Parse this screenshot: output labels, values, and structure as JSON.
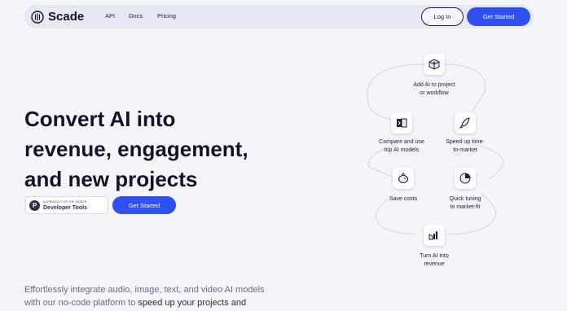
{
  "nav": {
    "brand": "Scade",
    "links": [
      "API",
      "Docs",
      "Pricing"
    ],
    "login": "Log In",
    "get_started": "Get Started"
  },
  "hero": {
    "title_lines": [
      "Convert AI into",
      "revenue, engagement,",
      "and new projects"
    ],
    "badge": {
      "icon_letter": "P",
      "top": "#1 PRODUCT OF THE MONTH",
      "bottom": "Developer Tools"
    },
    "cta": "Get Started",
    "subtext": {
      "line1": "Effortlessly integrate audio, image, text, and video AI models",
      "line2_plain": "with our no-code platform to ",
      "line2_em": "speed up your projects and"
    }
  },
  "flow": {
    "steps": [
      {
        "icon": "cube-plus-icon",
        "lines": [
          "Add AI to project",
          "or workflow"
        ]
      },
      {
        "icon": "compare-models-icon",
        "lines": [
          "Compare and use",
          "top AI models"
        ]
      },
      {
        "icon": "rocket-icon",
        "lines": [
          "Speed up time-",
          "to-market"
        ]
      },
      {
        "icon": "piggy-bank-icon",
        "lines": [
          "Save costs"
        ]
      },
      {
        "icon": "pie-chart-icon",
        "lines": [
          "Quick tuning",
          "to market-fit"
        ]
      },
      {
        "icon": "growth-chart-icon",
        "lines": [
          "Turn AI into",
          "revenue"
        ]
      }
    ]
  },
  "colors": {
    "background": "#f4f5f9",
    "nav_background": "#e6e9f5",
    "accent": "#2f4ff1",
    "heading": "#141427",
    "muted_text": "#6a6c82"
  }
}
